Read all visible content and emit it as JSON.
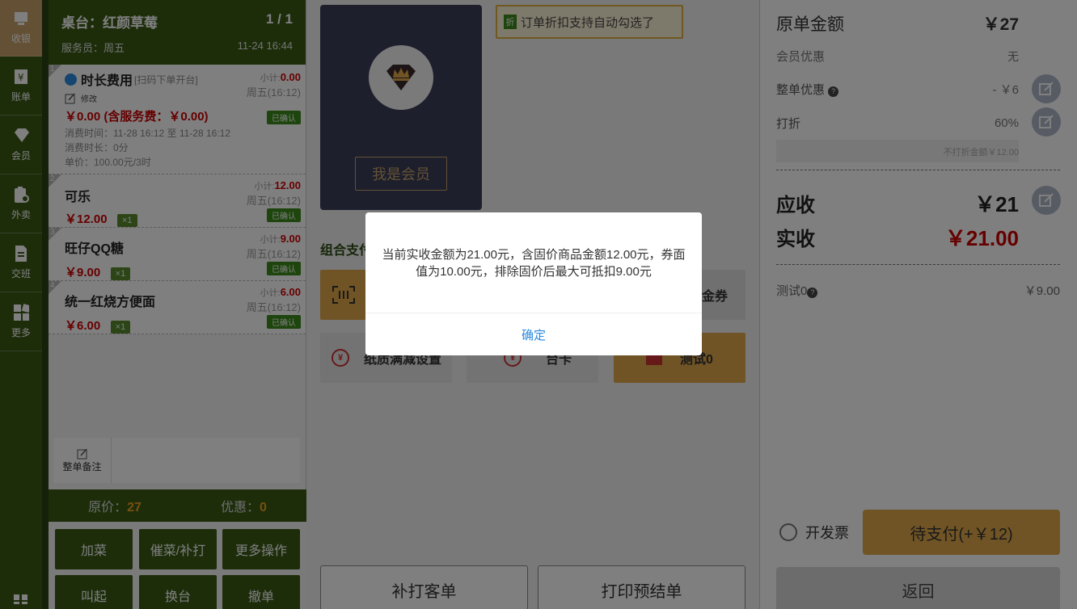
{
  "nav": {
    "items": [
      {
        "label": "收银",
        "icon": "cashier-icon"
      },
      {
        "label": "账单",
        "icon": "bill-icon"
      },
      {
        "label": "会员",
        "icon": "member-icon"
      },
      {
        "label": "外卖",
        "icon": "takeout-icon"
      },
      {
        "label": "交班",
        "icon": "shift-icon"
      },
      {
        "label": "更多",
        "icon": "more-icon"
      }
    ]
  },
  "order": {
    "table": "桌台：红颜草莓",
    "page": "1 / 1",
    "waiter": "服务员：周五",
    "time": "11-24 16:44",
    "items": [
      {
        "num": "1",
        "name": "时长费用",
        "tag": "[扫码下单开台]",
        "subtotal_label": "小计:",
        "subtotal": "0.00",
        "when": "周五(16:12)",
        "edit": "修改",
        "price": "￥0.00 (含服务费：￥0.00)",
        "status": "已确认",
        "line1": "消费时间：11-28 16:12 至 11-28 16:12",
        "line2": "消费时长：0分",
        "line3": "单价：100.00元/3时"
      },
      {
        "num": "2",
        "name": "可乐",
        "subtotal_label": "小计:",
        "subtotal": "12.00",
        "when": "周五(16:12)",
        "price": "￥12.00",
        "qty": "×1",
        "status": "已确认"
      },
      {
        "num": "3",
        "name": "旺仔QQ糖",
        "subtotal_label": "小计:",
        "subtotal": "9.00",
        "when": "周五(16:12)",
        "price": "￥9.00",
        "qty": "×1",
        "status": "已确认"
      },
      {
        "num": "4",
        "name": "统一红烧方便面",
        "subtotal_label": "小计:",
        "subtotal": "6.00",
        "when": "周五(16:12)",
        "price": "￥6.00",
        "qty": "×1",
        "status": "已确认"
      }
    ],
    "remark": "整单备注",
    "orig_label": "原价：",
    "orig_value": "27",
    "disc_label": "优惠：",
    "disc_value": "0",
    "buttons": [
      "加菜",
      "催菜/补打",
      "更多操作",
      "叫起",
      "换台",
      "撤单"
    ]
  },
  "middle": {
    "member_btn": "我是会员",
    "tip_badge": "折",
    "tip": "订单折扣支持自动勾选了",
    "combo_title": "组合支付",
    "tiles": [
      "金券",
      "纸质满减设置",
      "台卡",
      "测试0"
    ],
    "reprint": "补打客单",
    "preprint": "打印预结单"
  },
  "right": {
    "orig_label": "原单金额",
    "orig_value": "￥27",
    "member_label": "会员优惠",
    "member_value": "无",
    "whole_label": "整单优惠",
    "whole_value": "- ￥6",
    "discount_label": "打折",
    "discount_value": "60%",
    "nodisc_note": "不打折金额￥12.00",
    "due_label": "应收",
    "due_value": "￥21",
    "paid_label": "实收",
    "paid_value": "￥21.00",
    "test_label": "测试0",
    "test_value": "￥9.00",
    "invoice": "开发票",
    "pay_btn": "待支付(+￥12)",
    "back": "返回"
  },
  "modal": {
    "message": "当前实收金额为21.00元，含固价商品金额12.00元，券面值为10.00元，排除固价后最大可抵扣9.00元",
    "ok": "确定"
  },
  "colors": {
    "brand_green": "#3a5a14",
    "gold": "#c9a36b",
    "red": "#cc0000",
    "link": "#2a8ae0"
  }
}
